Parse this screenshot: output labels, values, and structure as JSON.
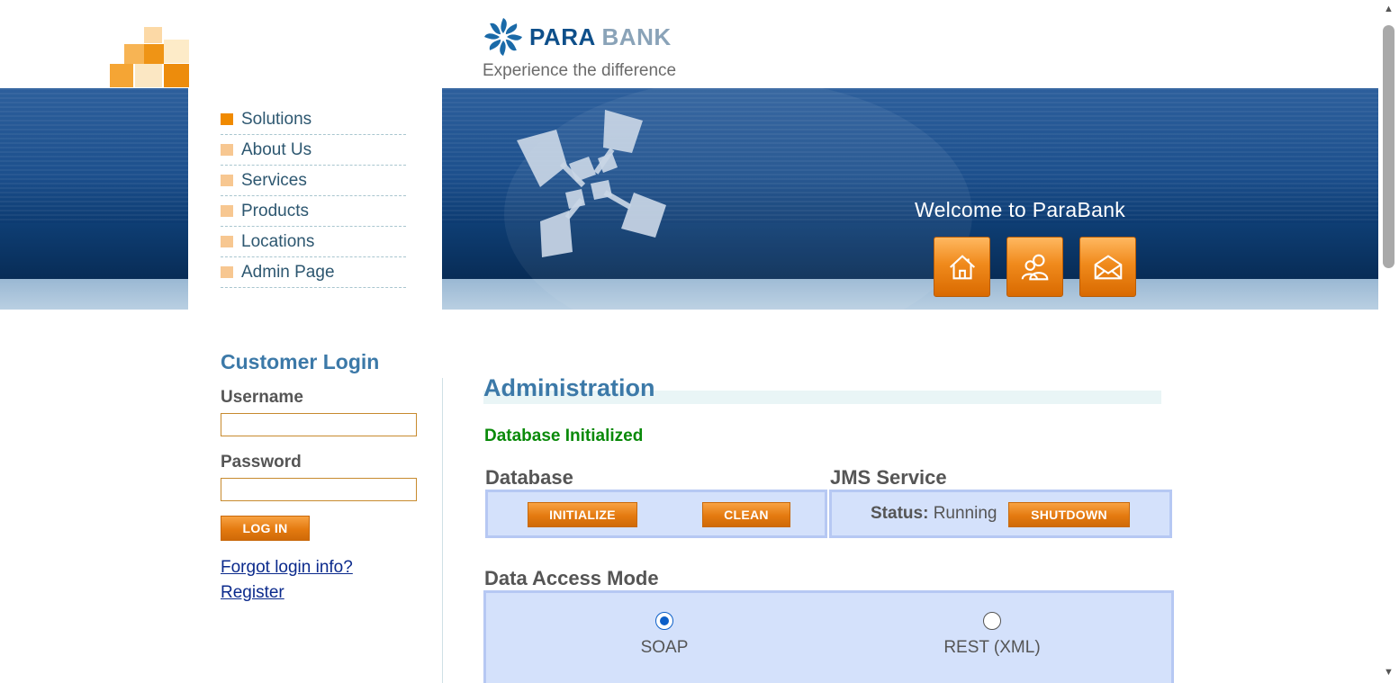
{
  "brand": {
    "name_part1": "PARA",
    "name_part2": "BANK",
    "tagline": "Experience the difference"
  },
  "banner": {
    "welcome": "Welcome to ParaBank"
  },
  "topnav": {
    "home_icon": "home-icon",
    "about_icon": "people-icon",
    "contact_icon": "envelope-icon"
  },
  "menu": {
    "items": [
      {
        "label": "Solutions",
        "active": true
      },
      {
        "label": "About Us"
      },
      {
        "label": "Services"
      },
      {
        "label": "Products"
      },
      {
        "label": "Locations"
      },
      {
        "label": "Admin Page"
      }
    ]
  },
  "login": {
    "title": "Customer Login",
    "username_label": "Username",
    "username_value": "",
    "password_label": "Password",
    "password_value": "",
    "submit": "LOG IN",
    "forgot": "Forgot login info?",
    "register": "Register"
  },
  "admin": {
    "title": "Administration",
    "message": "Database Initialized",
    "database": {
      "title": "Database",
      "initialize": "INITIALIZE",
      "clean": "CLEAN"
    },
    "jms": {
      "title": "JMS Service",
      "status_label": "Status:",
      "status_value": "Running",
      "shutdown": "SHUTDOWN"
    },
    "access_mode": {
      "title": "Data Access Mode",
      "options": [
        {
          "label": "SOAP",
          "selected": true
        },
        {
          "label": "REST (XML)",
          "selected": false
        }
      ]
    }
  },
  "colors": {
    "accent_orange": "#f08a00",
    "title_blue": "#3c79a8",
    "success_green": "#0a8a0a",
    "panel_blue": "#d4e1fb"
  }
}
